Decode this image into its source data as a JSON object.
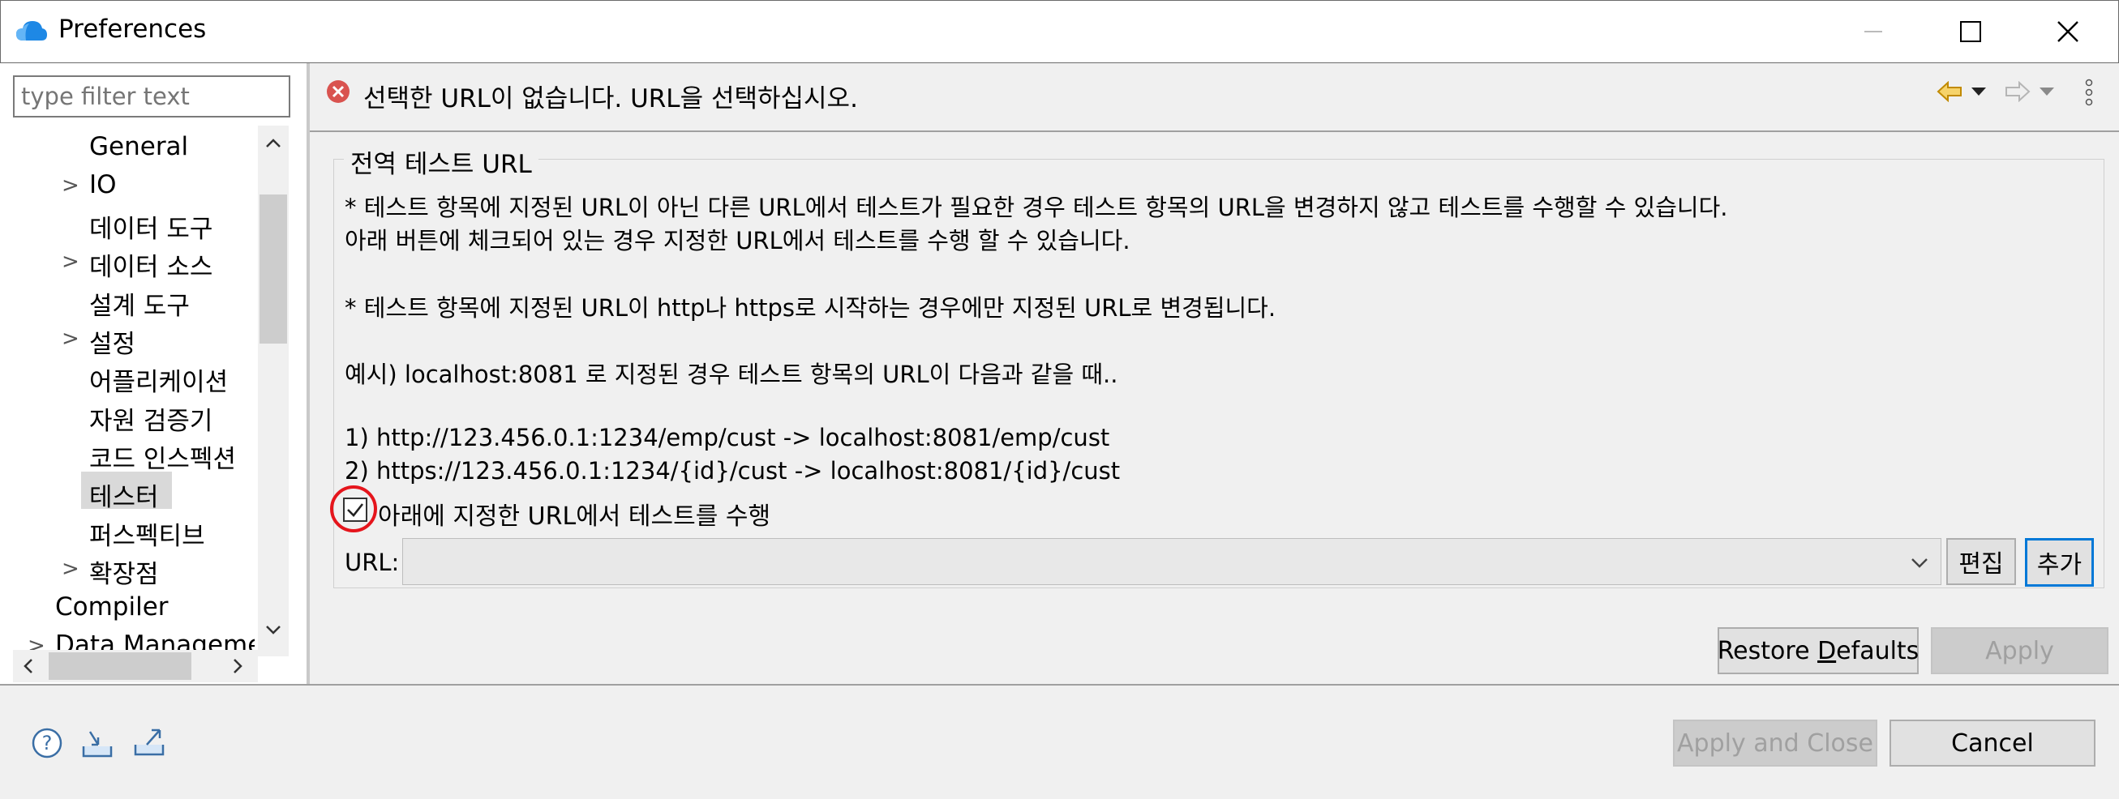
{
  "window": {
    "title": "Preferences",
    "minimize": "—",
    "maximize": "☐",
    "close": "✕"
  },
  "filter": {
    "placeholder": "type filter text"
  },
  "tree": [
    {
      "label": "General",
      "arrow": ""
    },
    {
      "label": "IO",
      "arrow": ">"
    },
    {
      "label": "데이터 도구",
      "arrow": ""
    },
    {
      "label": "데이터 소스",
      "arrow": ">"
    },
    {
      "label": "설계 도구",
      "arrow": ""
    },
    {
      "label": "설정",
      "arrow": ">"
    },
    {
      "label": "어플리케이션",
      "arrow": ""
    },
    {
      "label": "자원 검증기",
      "arrow": ""
    },
    {
      "label": "코드 인스펙션",
      "arrow": ""
    },
    {
      "label": "테스터",
      "arrow": ""
    },
    {
      "label": "퍼스펙티브",
      "arrow": ""
    },
    {
      "label": "확장점",
      "arrow": ">"
    },
    {
      "label": "Compiler",
      "arrow": ""
    },
    {
      "label": "Data Managemer",
      "arrow": ">"
    }
  ],
  "header": {
    "error_message": "선택한 URL이 없습니다. URL을 선택하십시오."
  },
  "group": {
    "title": "전역 테스트 URL",
    "lines": [
      "* 테스트 항목에 지정된 URL이 아닌 다른 URL에서 테스트가 필요한 경우 테스트 항목의 URL을 변경하지 않고 테스트를 수행할 수 있습니다.",
      "아래 버튼에 체크되어 있는 경우 지정한 URL에서 테스트를 수행 할 수 있습니다.",
      "* 테스트 항목에 지정된 URL이 http나 https로 시작하는 경우에만 지정된 URL로 변경됩니다.",
      "예시) localhost:8081 로 지정된 경우 테스트 항목의 URL이 다음과 같을 때..",
      "1) http://123.456.0.1:1234/emp/cust -> localhost:8081/emp/cust",
      "2) https://123.456.0.1:1234/{id}/cust -> localhost:8081/{id}/cust"
    ],
    "checkbox_label": "아래에 지정한 URL에서 테스트를 수행",
    "checkbox_checked": true,
    "url_label": "URL:",
    "url_value": "",
    "edit_button": "편집",
    "add_button": "추가"
  },
  "buttons": {
    "restore_prefix": "Restore ",
    "restore_underline": "D",
    "restore_suffix": "efaults",
    "apply": "Apply",
    "apply_and_close": "Apply and Close",
    "cancel": "Cancel"
  },
  "colors": {
    "highlight_circle": "#e5151c",
    "selected_tree_bg": "#d9d9d9",
    "focus_border": "#0078d7",
    "error_icon": "#d9534f"
  }
}
